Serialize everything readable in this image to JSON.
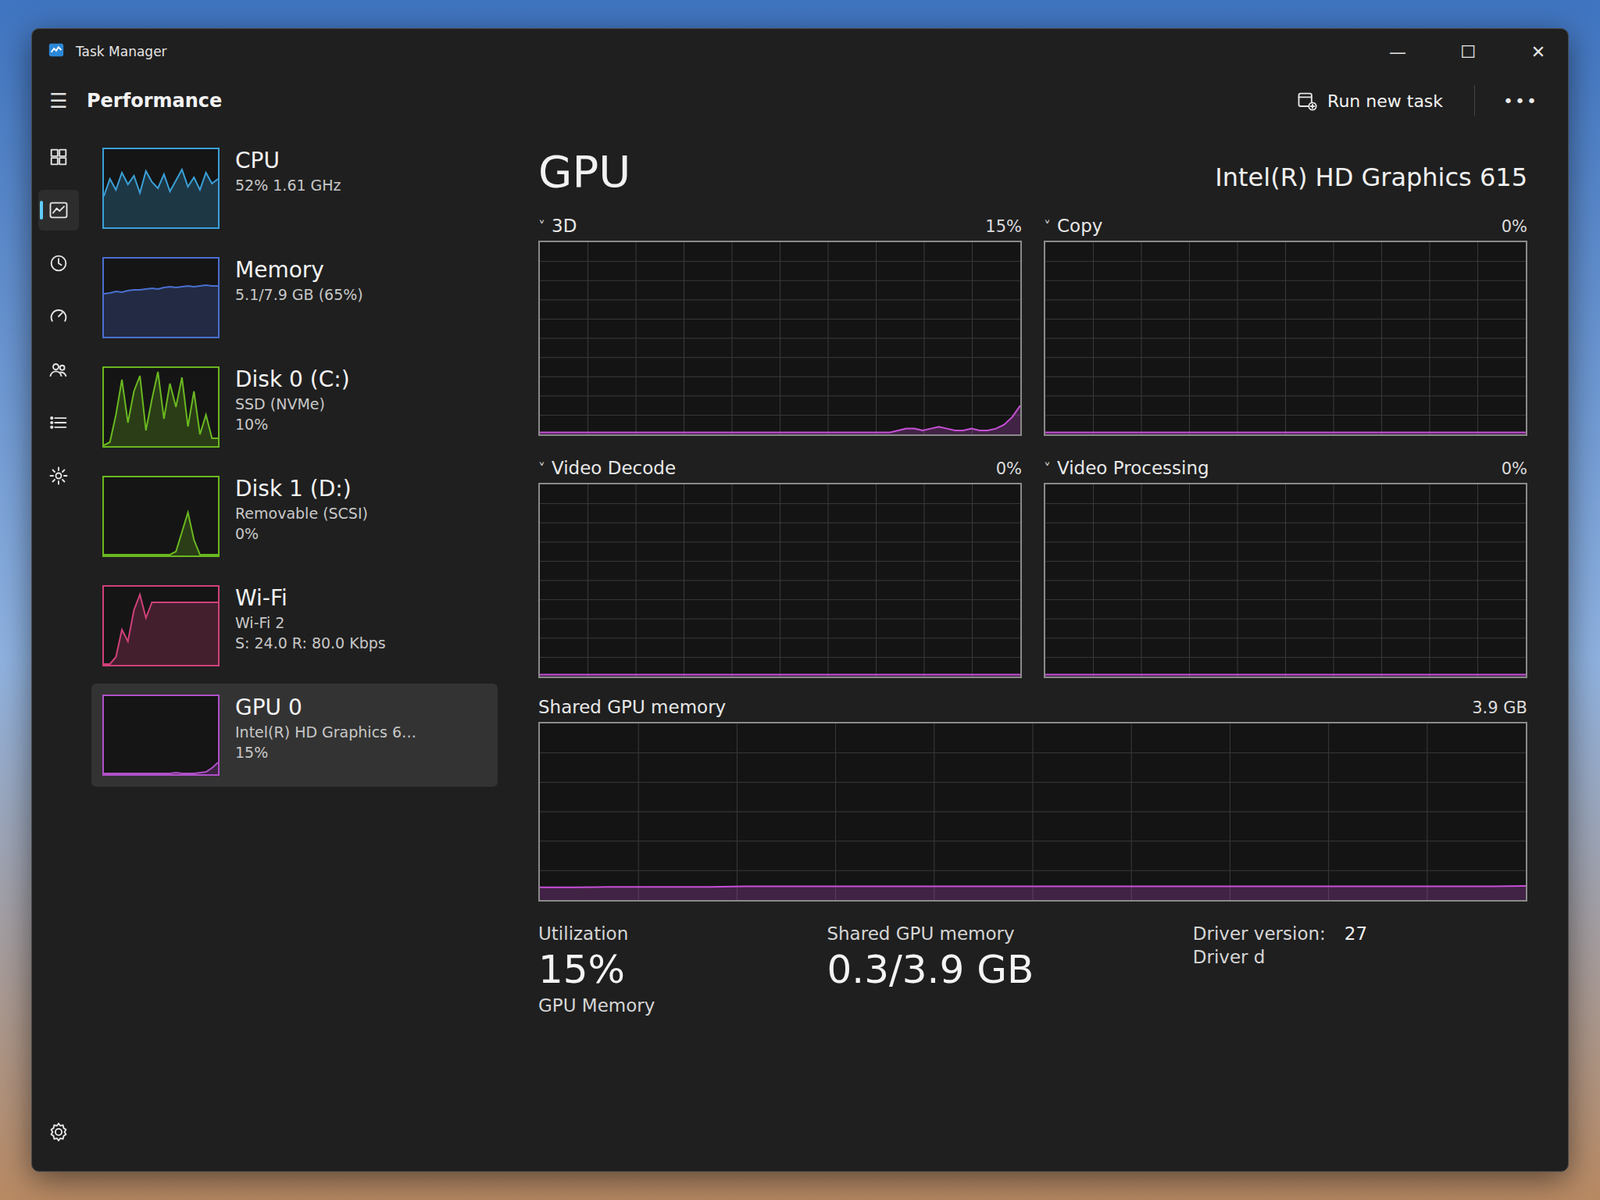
{
  "window": {
    "title": "Task Manager",
    "controls": [
      "—",
      "☐",
      "✕"
    ]
  },
  "header": {
    "menu": "☰",
    "section": "Performance",
    "run_task": "Run new task",
    "more": "•••"
  },
  "nav": [
    {
      "selected": false
    },
    {
      "selected": true
    },
    {
      "selected": false
    },
    {
      "selected": false
    },
    {
      "selected": false
    },
    {
      "selected": false
    },
    {
      "selected": false
    },
    {
      "selected": false
    }
  ],
  "sidebar": {
    "items": [
      {
        "name": "CPU",
        "lines": [
          "52% 1.61 GHz"
        ],
        "selected": false,
        "color": "#3aa0d8",
        "values": [
          40,
          62,
          48,
          70,
          55,
          66,
          44,
          72,
          58,
          50,
          68,
          46,
          60,
          74,
          52,
          64,
          48,
          70,
          56,
          62
        ]
      },
      {
        "name": "Memory",
        "lines": [
          "5.1/7.9 GB (65%)"
        ],
        "selected": false,
        "color": "#4a6fd0",
        "values": [
          55,
          56,
          58,
          57,
          59,
          60,
          60,
          61,
          62,
          61,
          63,
          64,
          63,
          64,
          65,
          64,
          65,
          66,
          65,
          65
        ]
      },
      {
        "name": "Disk 0 (C:)",
        "lines": [
          "SSD (NVMe)",
          "10%"
        ],
        "selected": false,
        "color": "#6ab820",
        "values": [
          0,
          5,
          40,
          85,
          30,
          70,
          90,
          20,
          60,
          95,
          35,
          80,
          50,
          88,
          25,
          70,
          15,
          40,
          10,
          10
        ]
      },
      {
        "name": "Disk 1 (D:)",
        "lines": [
          "Removable (SCSI)",
          "0%"
        ],
        "selected": false,
        "color": "#6ab820",
        "values": [
          0,
          0,
          0,
          0,
          0,
          0,
          0,
          0,
          0,
          0,
          0,
          0,
          5,
          30,
          55,
          20,
          0,
          0,
          0,
          0
        ]
      },
      {
        "name": "Wi-Fi",
        "lines": [
          "Wi-Fi 2",
          "S: 24.0 R: 80.0 Kbps"
        ],
        "selected": false,
        "color": "#d0407a",
        "values": [
          0,
          0,
          10,
          45,
          30,
          70,
          90,
          60,
          80,
          80,
          80,
          80,
          80,
          80,
          80,
          80,
          80,
          80,
          80,
          80
        ]
      },
      {
        "name": "GPU 0",
        "lines": [
          "Intel(R) HD Graphics 6…",
          "15%"
        ],
        "selected": true,
        "color": "#b050c8",
        "values": [
          0,
          0,
          1,
          0,
          0,
          1,
          0,
          0,
          0,
          1,
          0,
          0,
          2,
          1,
          0,
          1,
          2,
          3,
          8,
          15
        ]
      }
    ]
  },
  "gpu": {
    "title": "GPU",
    "adapter": "Intel(R) HD Graphics 615",
    "caret": "˅",
    "charts": [
      {
        "label": "3D",
        "reading": "15%",
        "values": [
          0,
          0,
          0,
          0,
          0,
          0,
          0,
          0,
          0,
          0,
          0,
          0,
          0,
          0,
          0,
          0,
          0,
          0,
          0,
          0,
          0,
          0,
          0,
          0,
          0,
          0,
          0,
          0,
          0,
          0,
          0,
          0,
          0,
          0,
          0,
          0,
          0,
          0,
          0,
          0,
          0,
          0,
          0,
          1,
          2,
          3,
          3,
          2,
          3,
          4,
          3,
          2,
          2,
          3,
          2,
          2,
          3,
          5,
          9,
          15
        ]
      },
      {
        "label": "Copy",
        "reading": "0%",
        "values": [
          0,
          0,
          0,
          0,
          0,
          0,
          0,
          0,
          0,
          0,
          0,
          0,
          0,
          0,
          0,
          0,
          0,
          0,
          0,
          0
        ]
      },
      {
        "label": "Video Decode",
        "reading": "0%",
        "values": [
          0,
          0,
          0,
          0,
          0,
          0,
          0,
          0,
          0,
          0,
          0,
          0,
          0,
          0,
          0,
          0,
          0,
          0,
          0,
          0
        ]
      },
      {
        "label": "Video Processing",
        "reading": "0%",
        "values": [
          0,
          0,
          0,
          0,
          0,
          0,
          0,
          0,
          0,
          0,
          0,
          0,
          0,
          0,
          0,
          0,
          0,
          0,
          0,
          0
        ]
      }
    ],
    "shared": {
      "label": "Shared GPU memory",
      "max": "3.9 GB",
      "values": [
        0.28,
        0.28,
        0.29,
        0.29,
        0.29,
        0.29,
        0.3,
        0.3,
        0.3,
        0.3,
        0.3,
        0.3,
        0.3,
        0.3,
        0.3,
        0.3,
        0.3,
        0.3,
        0.3,
        0.3,
        0.3,
        0.3,
        0.3,
        0.3,
        0.3,
        0.3,
        0.3,
        0.3,
        0.3,
        0.31
      ]
    },
    "stats": [
      {
        "label": "Utilization",
        "value": "15%"
      },
      {
        "label": "Shared GPU memory",
        "value": "0.3/3.9 GB"
      }
    ],
    "gpu_memory_label": "GPU Memory",
    "details": [
      {
        "label": "Driver version:",
        "value": "27"
      },
      {
        "label": "Driver d",
        "value": ""
      }
    ]
  }
}
